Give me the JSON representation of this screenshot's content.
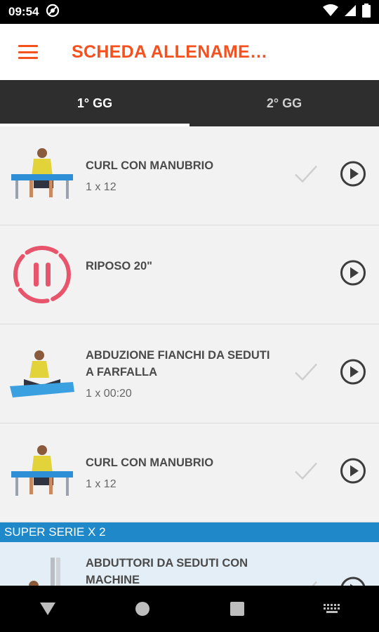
{
  "status_bar": {
    "time": "09:54"
  },
  "app_bar": {
    "title": "SCHEDA ALLENAME…"
  },
  "tabs": [
    {
      "label": "1° GG"
    },
    {
      "label": "2° GG"
    }
  ],
  "exercises": [
    {
      "name": "CURL CON MANUBRIO",
      "reps": "1 x 12",
      "icon": "bench-curl-illustration"
    },
    {
      "name": "RIPOSO 20\"",
      "reps": "",
      "icon": "rest-pause-icon"
    },
    {
      "name": "ABDUZIONE FIANCHI DA SEDUTI A FARFALLA",
      "reps": "1 x 00:20",
      "icon": "butterfly-stretch-illustration"
    },
    {
      "name": "CURL CON MANUBRIO",
      "reps": "1 x 12",
      "icon": "bench-curl-illustration"
    }
  ],
  "superset": {
    "label": "SUPER SERIE X 2",
    "items": [
      {
        "name": "ABDUTTORI DA SEDUTI CON MACHINE",
        "reps": ""
      }
    ]
  },
  "colors": {
    "accent": "#f4511e",
    "tab_bar": "#2e2e2e",
    "section": "#1e88c9",
    "rest": "#e8546b"
  }
}
